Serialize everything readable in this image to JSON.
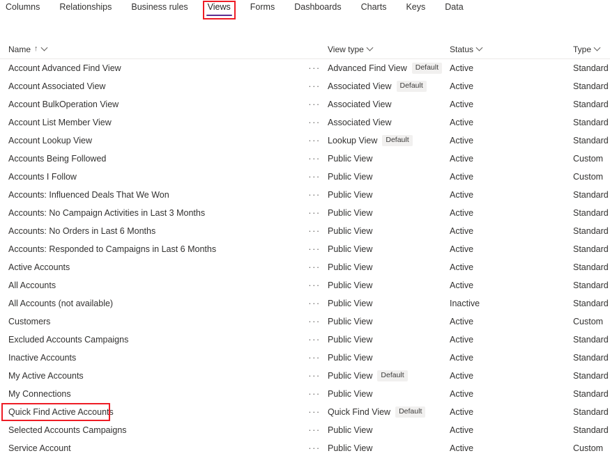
{
  "tabs": [
    {
      "label": "Columns",
      "selected": false
    },
    {
      "label": "Relationships",
      "selected": false
    },
    {
      "label": "Business rules",
      "selected": false
    },
    {
      "label": "Views",
      "selected": true
    },
    {
      "label": "Forms",
      "selected": false
    },
    {
      "label": "Dashboards",
      "selected": false
    },
    {
      "label": "Charts",
      "selected": false
    },
    {
      "label": "Keys",
      "selected": false
    },
    {
      "label": "Data",
      "selected": false
    }
  ],
  "annotations": {
    "highlight_color": "#ee1c25",
    "selected_tab_label": "Views",
    "highlighted_row_name": "Quick Find Active Accounts"
  },
  "theme": {
    "accent_underline": "#5c2e91",
    "text": "#323130",
    "badge_bg": "#f1f0ef",
    "divider": "#ebe9e7"
  },
  "grid": {
    "columns": [
      {
        "key": "name",
        "label": "Name",
        "sort": "↑",
        "has_menu": true
      },
      {
        "key": "view_type",
        "label": "View type",
        "sort": "",
        "has_menu": true
      },
      {
        "key": "status",
        "label": "Status",
        "sort": "",
        "has_menu": true
      },
      {
        "key": "type",
        "label": "Type",
        "sort": "",
        "has_menu": true
      }
    ],
    "overflow_glyph": "···",
    "default_badge_label": "Default",
    "rows": [
      {
        "name": "Account Advanced Find View",
        "view_type": "Advanced Find View",
        "is_default": true,
        "status": "Active",
        "type": "Standard",
        "highlighted": false
      },
      {
        "name": "Account Associated View",
        "view_type": "Associated View",
        "is_default": true,
        "status": "Active",
        "type": "Standard",
        "highlighted": false
      },
      {
        "name": "Account BulkOperation View",
        "view_type": "Associated View",
        "is_default": false,
        "status": "Active",
        "type": "Standard",
        "highlighted": false
      },
      {
        "name": "Account List Member View",
        "view_type": "Associated View",
        "is_default": false,
        "status": "Active",
        "type": "Standard",
        "highlighted": false
      },
      {
        "name": "Account Lookup View",
        "view_type": "Lookup View",
        "is_default": true,
        "status": "Active",
        "type": "Standard",
        "highlighted": false
      },
      {
        "name": "Accounts Being Followed",
        "view_type": "Public View",
        "is_default": false,
        "status": "Active",
        "type": "Custom",
        "highlighted": false
      },
      {
        "name": "Accounts I Follow",
        "view_type": "Public View",
        "is_default": false,
        "status": "Active",
        "type": "Custom",
        "highlighted": false
      },
      {
        "name": "Accounts: Influenced Deals That We Won",
        "view_type": "Public View",
        "is_default": false,
        "status": "Active",
        "type": "Standard",
        "highlighted": false
      },
      {
        "name": "Accounts: No Campaign Activities in Last 3 Months",
        "view_type": "Public View",
        "is_default": false,
        "status": "Active",
        "type": "Standard",
        "highlighted": false
      },
      {
        "name": "Accounts: No Orders in Last 6 Months",
        "view_type": "Public View",
        "is_default": false,
        "status": "Active",
        "type": "Standard",
        "highlighted": false
      },
      {
        "name": "Accounts: Responded to Campaigns in Last 6 Months",
        "view_type": "Public View",
        "is_default": false,
        "status": "Active",
        "type": "Standard",
        "highlighted": false
      },
      {
        "name": "Active Accounts",
        "view_type": "Public View",
        "is_default": false,
        "status": "Active",
        "type": "Standard",
        "highlighted": false
      },
      {
        "name": "All Accounts",
        "view_type": "Public View",
        "is_default": false,
        "status": "Active",
        "type": "Standard",
        "highlighted": false
      },
      {
        "name": "All Accounts (not available)",
        "view_type": "Public View",
        "is_default": false,
        "status": "Inactive",
        "type": "Standard",
        "highlighted": false
      },
      {
        "name": "Customers",
        "view_type": "Public View",
        "is_default": false,
        "status": "Active",
        "type": "Custom",
        "highlighted": false
      },
      {
        "name": "Excluded Accounts Campaigns",
        "view_type": "Public View",
        "is_default": false,
        "status": "Active",
        "type": "Standard",
        "highlighted": false
      },
      {
        "name": "Inactive Accounts",
        "view_type": "Public View",
        "is_default": false,
        "status": "Active",
        "type": "Standard",
        "highlighted": false
      },
      {
        "name": "My Active Accounts",
        "view_type": "Public View",
        "is_default": true,
        "status": "Active",
        "type": "Standard",
        "highlighted": false
      },
      {
        "name": "My Connections",
        "view_type": "Public View",
        "is_default": false,
        "status": "Active",
        "type": "Standard",
        "highlighted": false
      },
      {
        "name": "Quick Find Active Accounts",
        "view_type": "Quick Find View",
        "is_default": true,
        "status": "Active",
        "type": "Standard",
        "highlighted": true
      },
      {
        "name": "Selected Accounts Campaigns",
        "view_type": "Public View",
        "is_default": false,
        "status": "Active",
        "type": "Standard",
        "highlighted": false
      },
      {
        "name": "Service Account",
        "view_type": "Public View",
        "is_default": false,
        "status": "Active",
        "type": "Custom",
        "highlighted": false
      }
    ]
  }
}
